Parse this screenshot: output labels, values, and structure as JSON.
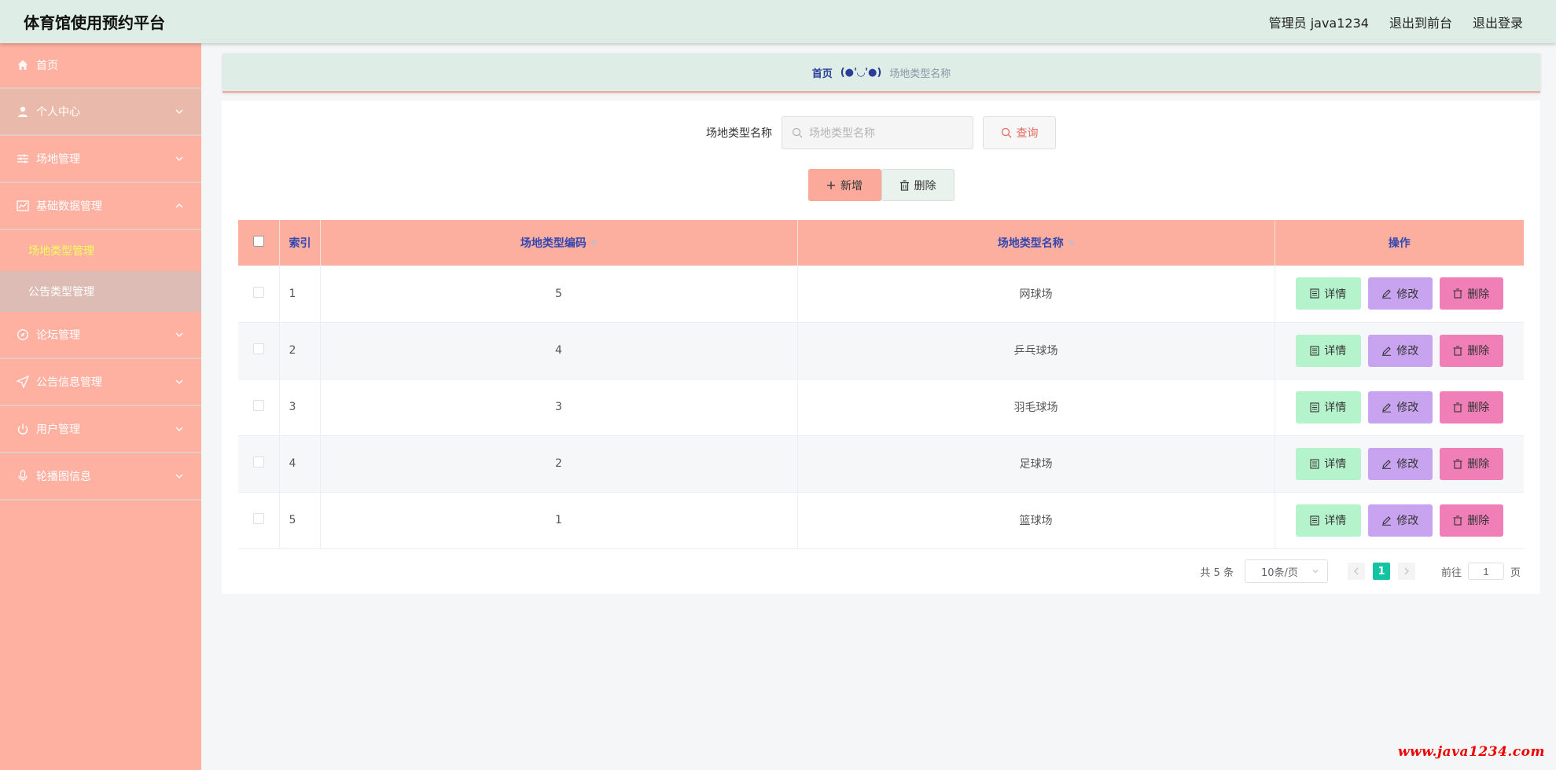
{
  "header": {
    "title": "体育馆使用预约平台",
    "admin": "管理员 java1234",
    "to_front": "退出到前台",
    "logout": "退出登录"
  },
  "sidebar": {
    "items": [
      {
        "label": "首页",
        "icon": "home-icon"
      },
      {
        "label": "个人中心",
        "icon": "user-icon"
      },
      {
        "label": "场地管理",
        "icon": "sliders-icon"
      },
      {
        "label": "基础数据管理",
        "icon": "chart-icon"
      },
      {
        "label": "论坛管理",
        "icon": "compass-icon"
      },
      {
        "label": "公告信息管理",
        "icon": "send-icon"
      },
      {
        "label": "用户管理",
        "icon": "power-icon"
      },
      {
        "label": "轮播图信息",
        "icon": "mic-icon"
      }
    ],
    "subitems": [
      {
        "label": "场地类型管理"
      },
      {
        "label": "公告类型管理"
      }
    ]
  },
  "breadcrumb": {
    "home": "首页",
    "separator": "(●'◡'●)",
    "current": "场地类型名称"
  },
  "search": {
    "label": "场地类型名称",
    "placeholder": "场地类型名称",
    "query_label": "查询"
  },
  "actions": {
    "add_label": "新增",
    "delete_label": "删除"
  },
  "table": {
    "columns": [
      "索引",
      "场地类型编码",
      "场地类型名称",
      "操作"
    ],
    "rows": [
      {
        "index": "1",
        "code": "5",
        "name": "网球场"
      },
      {
        "index": "2",
        "code": "4",
        "name": "乒乓球场"
      },
      {
        "index": "3",
        "code": "3",
        "name": "羽毛球场"
      },
      {
        "index": "4",
        "code": "2",
        "name": "足球场"
      },
      {
        "index": "5",
        "code": "1",
        "name": "篮球场"
      }
    ],
    "row_actions": {
      "detail": "详情",
      "edit": "修改",
      "delete": "删除"
    }
  },
  "pagination": {
    "total": "共 5 条",
    "page_size": "10条/页",
    "current_page": "1",
    "goto_prefix": "前往",
    "goto_value": "1",
    "goto_suffix": "页"
  },
  "watermark": "www.java1234.com",
  "colors": {
    "header_bg": "#deede5",
    "sidebar_bg": "#feb0a1",
    "table_header_bg": "#fcaf9f",
    "active_sub": "#f3ff5a",
    "pager_active": "#13c4a3"
  }
}
